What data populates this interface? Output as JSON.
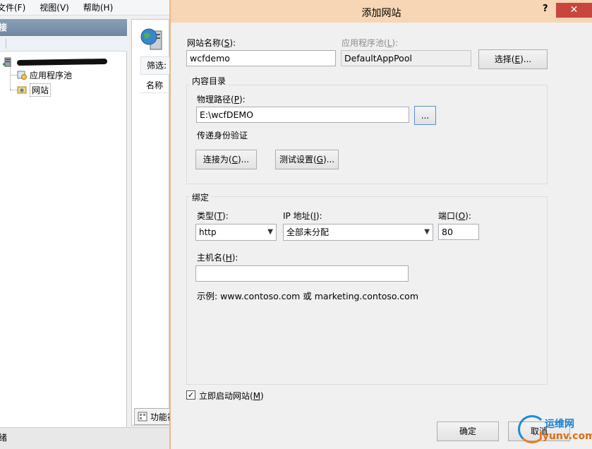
{
  "background_app": {
    "menu": [
      "文件(F)",
      "视图(V)",
      "帮助(H)"
    ],
    "connections_title": "接",
    "tree": {
      "app_pools": "应用程序池",
      "sites": "网站"
    },
    "filter_label": "筛选:",
    "name_column": "名称",
    "features_tab": "功能视",
    "status_text": "绪"
  },
  "dialog": {
    "title": "添加网站",
    "help": "?",
    "close": "✕",
    "site_name": {
      "label_pre": "网站名称(",
      "label_key": "S",
      "label_post": "):",
      "value": "wcfdemo"
    },
    "app_pool": {
      "label_pre": "应用程序池(",
      "label_key": "L",
      "label_post": "):",
      "value": "DefaultAppPool"
    },
    "select_button": {
      "pre": "选择(",
      "key": "E",
      "post": ")..."
    },
    "content_dir": {
      "group_title": "内容目录",
      "physical_path": {
        "label_pre": "物理路径(",
        "label_key": "P",
        "label_post": "):",
        "value": "E:\\wcfDEMO"
      },
      "browse_button": "...",
      "pass_through_auth": "传递身份验证",
      "connect_as": {
        "pre": "连接为(",
        "key": "C",
        "post": ")..."
      },
      "test_settings": {
        "pre": "测试设置(",
        "key": "G",
        "post": ")..."
      }
    },
    "binding": {
      "group_title": "绑定",
      "type": {
        "label_pre": "类型(",
        "label_key": "T",
        "label_post": "):",
        "value": "http"
      },
      "ip": {
        "label_pre": "IP 地址(",
        "label_key": "I",
        "label_post": "):",
        "value": "全部未分配"
      },
      "port": {
        "label_pre": "端口(",
        "label_key": "O",
        "label_post": "):",
        "value": "80"
      },
      "host": {
        "label_pre": "主机名(",
        "label_key": "H",
        "label_post": "):",
        "value": ""
      },
      "example": "示例: www.contoso.com 或 marketing.contoso.com"
    },
    "autostart": {
      "checked": true,
      "label_pre": "立即启动网站(",
      "label_key": "M",
      "label_post": ")"
    },
    "ok_button": "确定",
    "cancel_button": "取消"
  },
  "watermark": {
    "line1": "运维网",
    "line2": "iyunv.com"
  },
  "colors": {
    "title_bar": "#f7d6b5",
    "close_button": "#c7463e",
    "connections_header": "#7a91ab"
  }
}
